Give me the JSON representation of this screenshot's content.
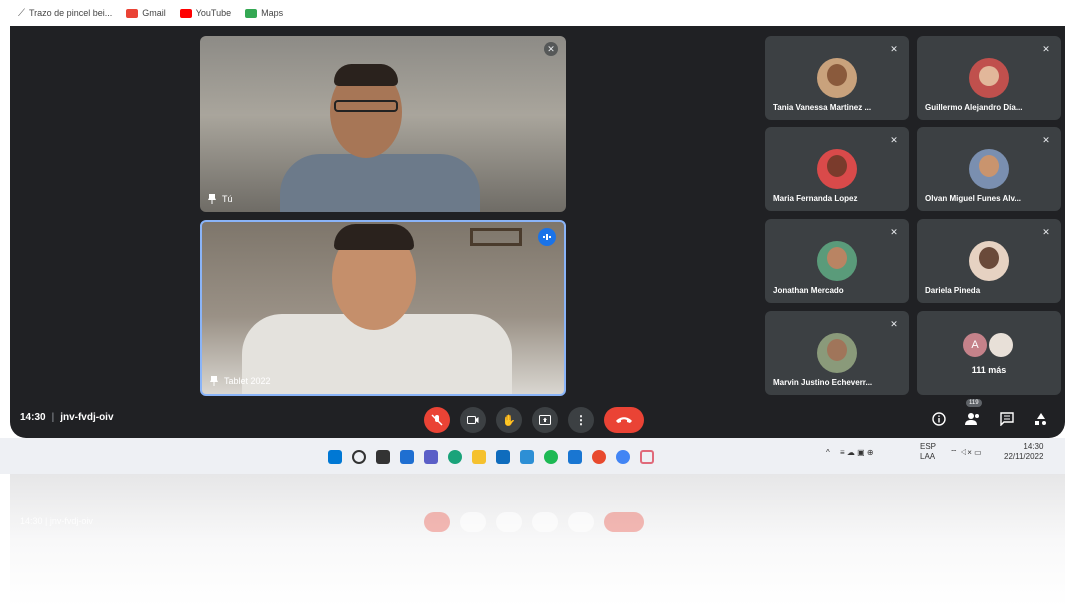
{
  "bookmarks": [
    {
      "label": "Trazo de pincel bei...",
      "color": "#888888"
    },
    {
      "label": "Gmail",
      "color": "#ea4335"
    },
    {
      "label": "YouTube",
      "color": "#ff0000"
    },
    {
      "label": "Maps",
      "color": "#34a853"
    }
  ],
  "main_tiles": {
    "self_name": "Tú",
    "speaker_name": "Tablet 2022"
  },
  "participants": [
    {
      "name": "Tania Vanessa Martinez ...",
      "color": "#c9a27c"
    },
    {
      "name": "Guillermo Alejandro Día...",
      "color": "#c0504d"
    },
    {
      "name": "Maria Fernanda Lopez",
      "color": "#d94a4a"
    },
    {
      "name": "Olvan Miguel Funes Alv...",
      "color": "#7a8fb0"
    },
    {
      "name": "Jonathan Mercado",
      "color": "#5a9b7a"
    },
    {
      "name": "Dariela Pineda",
      "color": "#e6d2c2"
    },
    {
      "name": "Marvin Justino Echeverr...",
      "color": "#8a9a7a"
    }
  ],
  "more": {
    "avatar_letter": "A",
    "label": "111 más"
  },
  "meeting": {
    "time": "14:30",
    "separator": "|",
    "code": "jnv-fvdj-oiv",
    "participant_count": "119"
  },
  "taskbar": {
    "language": "ESP",
    "language_sub": "LAA",
    "time": "14:30",
    "date": "22/11/2022"
  },
  "reflection": {
    "text": "14:30 | jnv-fvdj-oiv"
  },
  "colors": {
    "meet_bg": "#202124",
    "tile_bg": "#3c4043",
    "accent": "#1a73e8",
    "red": "#ea4335"
  }
}
